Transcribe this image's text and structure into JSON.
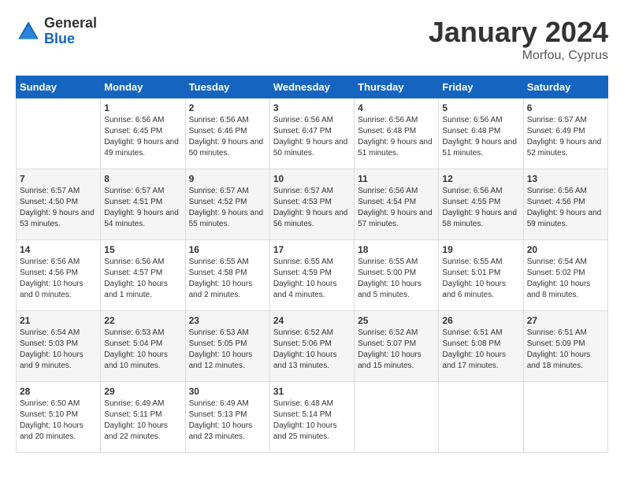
{
  "header": {
    "logo_line1": "General",
    "logo_line2": "Blue",
    "month_year": "January 2024",
    "location": "Morfou, Cyprus"
  },
  "weekdays": [
    "Sunday",
    "Monday",
    "Tuesday",
    "Wednesday",
    "Thursday",
    "Friday",
    "Saturday"
  ],
  "weeks": [
    [
      {
        "day": "",
        "sunrise": "",
        "sunset": "",
        "daylight": ""
      },
      {
        "day": "1",
        "sunrise": "Sunrise: 6:56 AM",
        "sunset": "Sunset: 6:45 PM",
        "daylight": "Daylight: 9 hours and 49 minutes."
      },
      {
        "day": "2",
        "sunrise": "Sunrise: 6:56 AM",
        "sunset": "Sunset: 6:46 PM",
        "daylight": "Daylight: 9 hours and 50 minutes."
      },
      {
        "day": "3",
        "sunrise": "Sunrise: 6:56 AM",
        "sunset": "Sunset: 6:47 PM",
        "daylight": "Daylight: 9 hours and 50 minutes."
      },
      {
        "day": "4",
        "sunrise": "Sunrise: 6:56 AM",
        "sunset": "Sunset: 6:48 PM",
        "daylight": "Daylight: 9 hours and 51 minutes."
      },
      {
        "day": "5",
        "sunrise": "Sunrise: 6:56 AM",
        "sunset": "Sunset: 6:48 PM",
        "daylight": "Daylight: 9 hours and 51 minutes."
      },
      {
        "day": "6",
        "sunrise": "Sunrise: 6:57 AM",
        "sunset": "Sunset: 6:49 PM",
        "daylight": "Daylight: 9 hours and 52 minutes."
      }
    ],
    [
      {
        "day": "7",
        "sunrise": "Sunrise: 6:57 AM",
        "sunset": "Sunset: 4:50 PM",
        "daylight": "Daylight: 9 hours and 53 minutes."
      },
      {
        "day": "8",
        "sunrise": "Sunrise: 6:57 AM",
        "sunset": "Sunset: 4:51 PM",
        "daylight": "Daylight: 9 hours and 54 minutes."
      },
      {
        "day": "9",
        "sunrise": "Sunrise: 6:57 AM",
        "sunset": "Sunset: 4:52 PM",
        "daylight": "Daylight: 9 hours and 55 minutes."
      },
      {
        "day": "10",
        "sunrise": "Sunrise: 6:57 AM",
        "sunset": "Sunset: 4:53 PM",
        "daylight": "Daylight: 9 hours and 56 minutes."
      },
      {
        "day": "11",
        "sunrise": "Sunrise: 6:56 AM",
        "sunset": "Sunset: 4:54 PM",
        "daylight": "Daylight: 9 hours and 57 minutes."
      },
      {
        "day": "12",
        "sunrise": "Sunrise: 6:56 AM",
        "sunset": "Sunset: 4:55 PM",
        "daylight": "Daylight: 9 hours and 58 minutes."
      },
      {
        "day": "13",
        "sunrise": "Sunrise: 6:56 AM",
        "sunset": "Sunset: 4:56 PM",
        "daylight": "Daylight: 9 hours and 59 minutes."
      }
    ],
    [
      {
        "day": "14",
        "sunrise": "Sunrise: 6:56 AM",
        "sunset": "Sunset: 4:56 PM",
        "daylight": "Daylight: 10 hours and 0 minutes."
      },
      {
        "day": "15",
        "sunrise": "Sunrise: 6:56 AM",
        "sunset": "Sunset: 4:57 PM",
        "daylight": "Daylight: 10 hours and 1 minute."
      },
      {
        "day": "16",
        "sunrise": "Sunrise: 6:55 AM",
        "sunset": "Sunset: 4:58 PM",
        "daylight": "Daylight: 10 hours and 2 minutes."
      },
      {
        "day": "17",
        "sunrise": "Sunrise: 6:55 AM",
        "sunset": "Sunset: 4:59 PM",
        "daylight": "Daylight: 10 hours and 4 minutes."
      },
      {
        "day": "18",
        "sunrise": "Sunrise: 6:55 AM",
        "sunset": "Sunset: 5:00 PM",
        "daylight": "Daylight: 10 hours and 5 minutes."
      },
      {
        "day": "19",
        "sunrise": "Sunrise: 6:55 AM",
        "sunset": "Sunset: 5:01 PM",
        "daylight": "Daylight: 10 hours and 6 minutes."
      },
      {
        "day": "20",
        "sunrise": "Sunrise: 6:54 AM",
        "sunset": "Sunset: 5:02 PM",
        "daylight": "Daylight: 10 hours and 8 minutes."
      }
    ],
    [
      {
        "day": "21",
        "sunrise": "Sunrise: 6:54 AM",
        "sunset": "Sunset: 5:03 PM",
        "daylight": "Daylight: 10 hours and 9 minutes."
      },
      {
        "day": "22",
        "sunrise": "Sunrise: 6:53 AM",
        "sunset": "Sunset: 5:04 PM",
        "daylight": "Daylight: 10 hours and 10 minutes."
      },
      {
        "day": "23",
        "sunrise": "Sunrise: 6:53 AM",
        "sunset": "Sunset: 5:05 PM",
        "daylight": "Daylight: 10 hours and 12 minutes."
      },
      {
        "day": "24",
        "sunrise": "Sunrise: 6:52 AM",
        "sunset": "Sunset: 5:06 PM",
        "daylight": "Daylight: 10 hours and 13 minutes."
      },
      {
        "day": "25",
        "sunrise": "Sunrise: 6:52 AM",
        "sunset": "Sunset: 5:07 PM",
        "daylight": "Daylight: 10 hours and 15 minutes."
      },
      {
        "day": "26",
        "sunrise": "Sunrise: 6:51 AM",
        "sunset": "Sunset: 5:08 PM",
        "daylight": "Daylight: 10 hours and 17 minutes."
      },
      {
        "day": "27",
        "sunrise": "Sunrise: 6:51 AM",
        "sunset": "Sunset: 5:09 PM",
        "daylight": "Daylight: 10 hours and 18 minutes."
      }
    ],
    [
      {
        "day": "28",
        "sunrise": "Sunrise: 6:50 AM",
        "sunset": "Sunset: 5:10 PM",
        "daylight": "Daylight: 10 hours and 20 minutes."
      },
      {
        "day": "29",
        "sunrise": "Sunrise: 6:49 AM",
        "sunset": "Sunset: 5:11 PM",
        "daylight": "Daylight: 10 hours and 22 minutes."
      },
      {
        "day": "30",
        "sunrise": "Sunrise: 6:49 AM",
        "sunset": "Sunset: 5:13 PM",
        "daylight": "Daylight: 10 hours and 23 minutes."
      },
      {
        "day": "31",
        "sunrise": "Sunrise: 6:48 AM",
        "sunset": "Sunset: 5:14 PM",
        "daylight": "Daylight: 10 hours and 25 minutes."
      },
      {
        "day": "",
        "sunrise": "",
        "sunset": "",
        "daylight": ""
      },
      {
        "day": "",
        "sunrise": "",
        "sunset": "",
        "daylight": ""
      },
      {
        "day": "",
        "sunrise": "",
        "sunset": "",
        "daylight": ""
      }
    ]
  ]
}
